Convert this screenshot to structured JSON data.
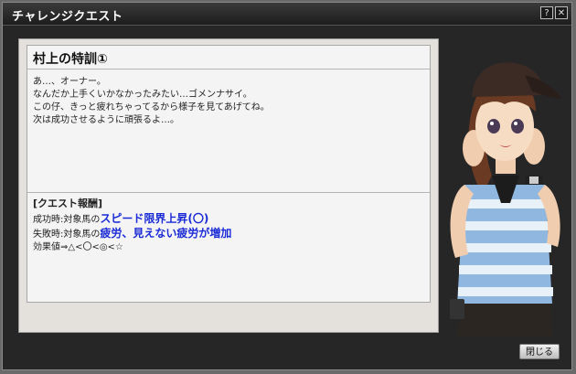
{
  "window": {
    "title": "チャレンジクエスト"
  },
  "titlebar_buttons": {
    "help": "?",
    "close": "✕"
  },
  "quest": {
    "name": "村上の特訓①",
    "message": [
      "あ…、オーナー。",
      "なんだか上手くいかなかったみたい…ゴメンナサイ。",
      "この仔、きっと疲れちゃってるから様子を見てあげてね。",
      "次は成功させるように頑張るよ…。"
    ]
  },
  "reward": {
    "header": "[クエスト報酬]",
    "success_prefix": "成功時:対象馬の",
    "success_value": "スピード限界上昇(〇)",
    "failure_prefix": "失敗時:対象馬の",
    "failure_value": "疲労、見えない疲労が増加",
    "effect_line": "効果値⇒△<〇<◎<☆"
  },
  "footer": {
    "close_label": "閉じる"
  },
  "colors": {
    "highlight": "#1a2bd6",
    "window_bg": "#262626",
    "panel_bg": "#e4e1dc"
  },
  "icons": {
    "portrait": "character-portrait"
  }
}
